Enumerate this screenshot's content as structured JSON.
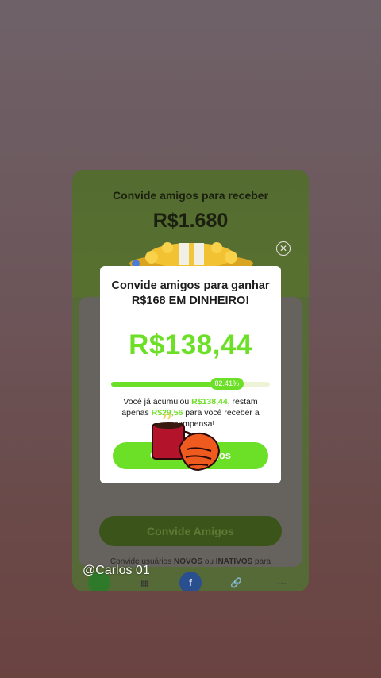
{
  "background": {
    "title": "Convide amigos para receber",
    "amount": "R$1.680",
    "button_label": "Convide Amigos",
    "note_prefix": "Convide usuários",
    "note_new": "NOVOS",
    "note_or": "ou",
    "note_inactive": "INATIVOS",
    "note_suffix": "para",
    "share_icons": [
      "whatsapp-icon",
      "qr-code-icon",
      "facebook-icon",
      "link-icon",
      "more-icon"
    ],
    "more_label": "···"
  },
  "modal": {
    "title": "Convide amigos para ganhar R$168 EM DINHEIRO!",
    "amount": "R$138,44",
    "progress_percent": 82.41,
    "progress_label": "82.41%",
    "text_prefix": "Você já acumulou",
    "accumulated": "R$138,44",
    "text_middle": ", restam apenas",
    "remaining": "R$29,56",
    "text_suffix": "para você receber a recompensa!",
    "button_label": "Convide Amigos"
  },
  "overlay": {
    "username": "@Carlos 01"
  },
  "colors": {
    "accent_green": "#6ce026",
    "modal_bg": "#ffffff"
  }
}
